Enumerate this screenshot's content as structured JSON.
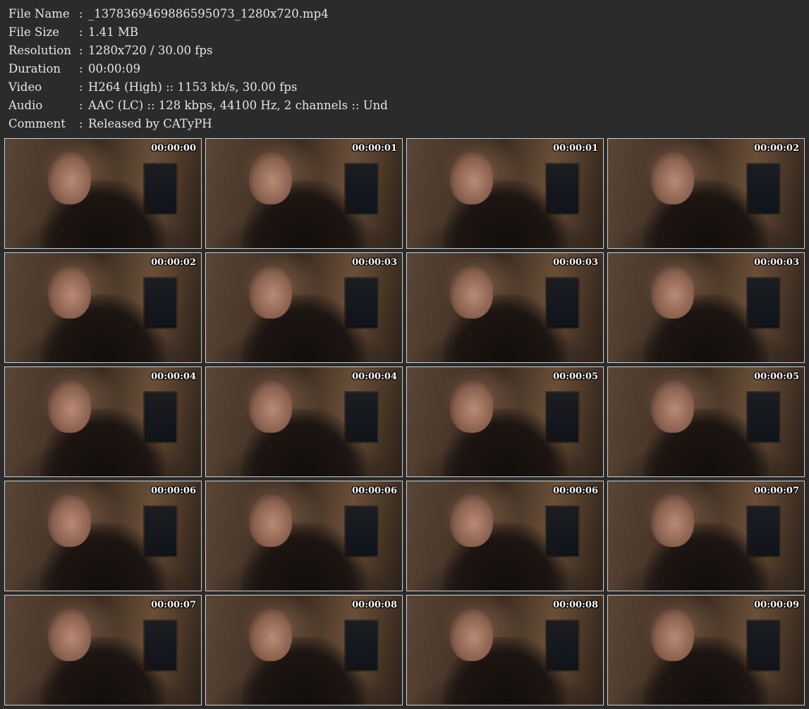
{
  "info": [
    {
      "key": "File Name",
      "sep": ":",
      "value": "_1378369469886595073_1280x720.mp4"
    },
    {
      "key": "File Size",
      "sep": ":",
      "value": "1.41 MB"
    },
    {
      "key": "Resolution",
      "sep": ":",
      "value": "1280x720 / 30.00 fps"
    },
    {
      "key": "Duration",
      "sep": ":",
      "value": "00:00:09"
    },
    {
      "key": "Video",
      "sep": ":",
      "value": "H264 (High) :: 1153 kb/s, 30.00 fps"
    },
    {
      "key": "Audio",
      "sep": ":",
      "value": "AAC (LC) :: 128 kbps, 44100 Hz, 2 channels :: Und"
    },
    {
      "key": "Comment",
      "sep": ":",
      "value": "Released by CATyPH"
    }
  ],
  "thumbnails": [
    {
      "timestamp": "00:00:00"
    },
    {
      "timestamp": "00:00:01"
    },
    {
      "timestamp": "00:00:01"
    },
    {
      "timestamp": "00:00:02"
    },
    {
      "timestamp": "00:00:02"
    },
    {
      "timestamp": "00:00:03"
    },
    {
      "timestamp": "00:00:03"
    },
    {
      "timestamp": "00:00:03"
    },
    {
      "timestamp": "00:00:04"
    },
    {
      "timestamp": "00:00:04"
    },
    {
      "timestamp": "00:00:05"
    },
    {
      "timestamp": "00:00:05"
    },
    {
      "timestamp": "00:00:06"
    },
    {
      "timestamp": "00:00:06"
    },
    {
      "timestamp": "00:00:06"
    },
    {
      "timestamp": "00:00:07"
    },
    {
      "timestamp": "00:00:07"
    },
    {
      "timestamp": "00:00:08"
    },
    {
      "timestamp": "00:00:08"
    },
    {
      "timestamp": "00:00:09"
    }
  ]
}
